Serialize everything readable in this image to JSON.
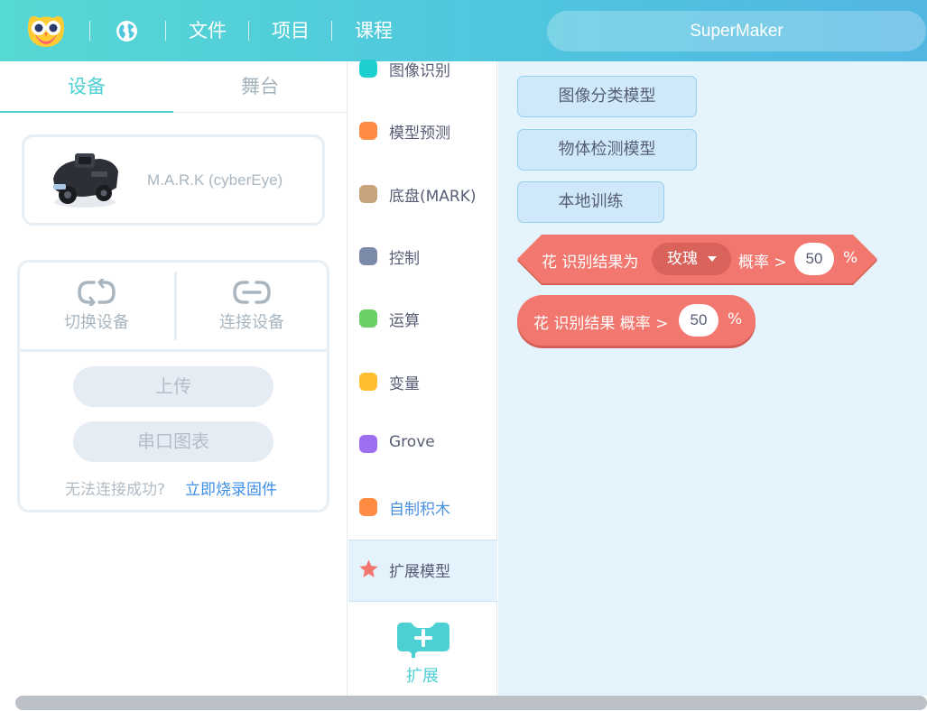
{
  "header": {
    "menu": [
      "文件",
      "项目",
      "课程"
    ],
    "project_name": "SuperMaker"
  },
  "left_panel": {
    "tabs": [
      "设备",
      "舞台"
    ],
    "device_name": "M.A.R.K (cyberEye)",
    "switch_label": "切换设备",
    "connect_label": "连接设备",
    "upload_label": "上传",
    "serial_chart_label": "串口图表",
    "fail_text": "无法连接成功?",
    "fail_link": "立即烧录固件"
  },
  "categories": [
    {
      "label": "图像识别",
      "color": "#1ecfcf"
    },
    {
      "label": "模型预测",
      "color": "#ff8c42"
    },
    {
      "label": "底盘(MARK)",
      "color": "#c8a27a"
    },
    {
      "label": "控制",
      "color": "#7b8aa6"
    },
    {
      "label": "运算",
      "color": "#6acf64"
    },
    {
      "label": "变量",
      "color": "#ffbf2e"
    },
    {
      "label": "Grove",
      "color": "#9b6ff0"
    },
    {
      "label": "自制积木",
      "color": "#ff8c42"
    },
    {
      "label": "扩展模型",
      "color": "#f2786f",
      "icon": "star-icon"
    }
  ],
  "extension_label": "扩展",
  "blocks": {
    "buttons": [
      "图像分类模型",
      "物体检测模型",
      "本地训练"
    ],
    "hex_block": {
      "prefix": "花 识别结果为",
      "dropdown": "玫瑰",
      "middle": "概率 >",
      "value": "50",
      "suffix": "%"
    },
    "round_block": {
      "prefix": "花 识别结果 概率 >",
      "value": "50",
      "suffix": "%"
    }
  }
}
